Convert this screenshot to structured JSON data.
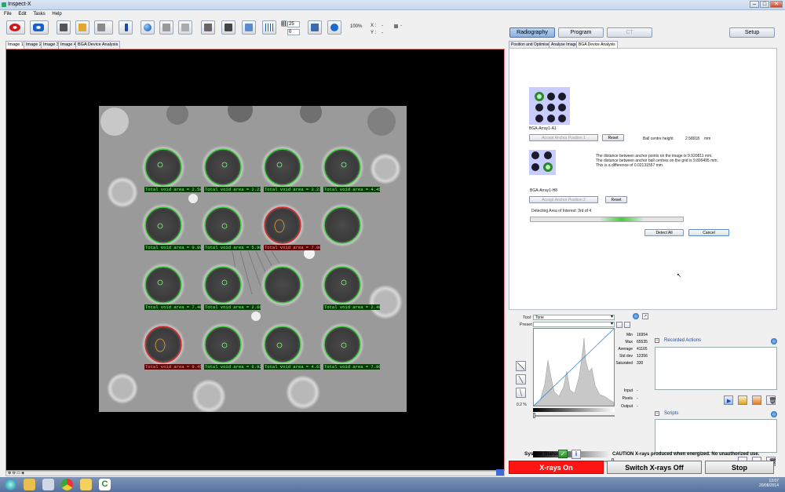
{
  "window": {
    "title": "Inspect-X"
  },
  "menu": [
    "File",
    "Edit",
    "Tasks",
    "Help"
  ],
  "toolbar": {
    "spin1": "25",
    "spin2": "0",
    "zoom": "100%",
    "x_label": "X :",
    "y_label": "Y :",
    "x_val": "-",
    "y_val": "-",
    "misc": "-"
  },
  "image_tabs": [
    "Image 1",
    "Image 2",
    "Image 3",
    "Image 4",
    "BGA Device Analysis"
  ],
  "void_labels": [
    {
      "text": "Total void area = 2.58%",
      "status": "ok"
    },
    {
      "text": "Total void area = 2.22%",
      "status": "ok"
    },
    {
      "text": "Total void area = 3.23%",
      "status": "ok"
    },
    {
      "text": "Total void area = 4.45%",
      "status": "ok"
    },
    {
      "text": "Total void area = 0.89%",
      "status": "ok"
    },
    {
      "text": "Total void area = 5.98%",
      "status": "ok"
    },
    {
      "text": "Total void area = 7.00%",
      "status": "fail"
    },
    {
      "text": "Total void area = 7.40%",
      "status": "ok"
    },
    {
      "text": "Total void area = 2.66%",
      "status": "ok"
    },
    {
      "text": "Total void area = 2.48%",
      "status": "ok"
    },
    {
      "text": "Total void area = 9.45%",
      "status": "fail"
    },
    {
      "text": "Total void area = 6.92%",
      "status": "ok"
    },
    {
      "text": "Total void area = 4.61%",
      "status": "ok"
    },
    {
      "text": "Total void area = 7.96%",
      "status": "ok"
    }
  ],
  "mode_tabs": {
    "radiography": "Radiography",
    "program": "Program",
    "ct": "CT",
    "setup": "Setup"
  },
  "sub_tabs": [
    "Position and Optimise",
    "Analyse Image",
    "BGA Device Analysis"
  ],
  "bga": {
    "anchor1_name": "BGA-Array1-A1",
    "accept1": "Accept Anchor Position 1",
    "reset1": "Reset",
    "ball_height_label": "Ball centre height",
    "ball_height_value": "2.58918",
    "ball_height_unit": "mm",
    "info1": "The distance between anchor points on the image is 9.920811 mm.",
    "info2": "The distance between anchor ball centres on the grid is 9.899495 mm.",
    "info3": "This is a difference of 0.02131557 mm.",
    "anchor2_name": "BGA-Array1-H8",
    "accept2": "Accept Anchor Position 2",
    "reset2": "Reset",
    "progress_label": "Detecting Area of Interest: 3rd of 4",
    "progress_fraction": 0.75,
    "detect_all": "Detect All",
    "cancel": "Cancel"
  },
  "tool": {
    "tool_label": "Tool",
    "tool_value": "Tone",
    "preset_label": "Preset",
    "preset_value": "",
    "percent": "0.2 %"
  },
  "stats": {
    "Min": "16954",
    "Max": "65535",
    "Average": "41165",
    "Std dev": "12356",
    "Saturated": "330"
  },
  "cursor": {
    "Input": "-",
    "Pixels": "-",
    "Output": "-"
  },
  "panels": {
    "recorded": "Recorded Actions",
    "scripts": "Scripts"
  },
  "status": {
    "system_status": "System Status",
    "caution": "CAUTION X-rays produced when energized. No unauthorized use."
  },
  "buttons": {
    "xrays_on": "X-rays On",
    "switch_off": "Switch X-rays Off",
    "stop": "Stop"
  },
  "colors": {
    "xrays_on_bg": "#ff1010",
    "mode_active": "#9cbce8",
    "void_ok": "#3fcf3f",
    "void_fail": "#e03030"
  },
  "clock": {
    "time": "13:07",
    "date": "20/08/2014"
  }
}
